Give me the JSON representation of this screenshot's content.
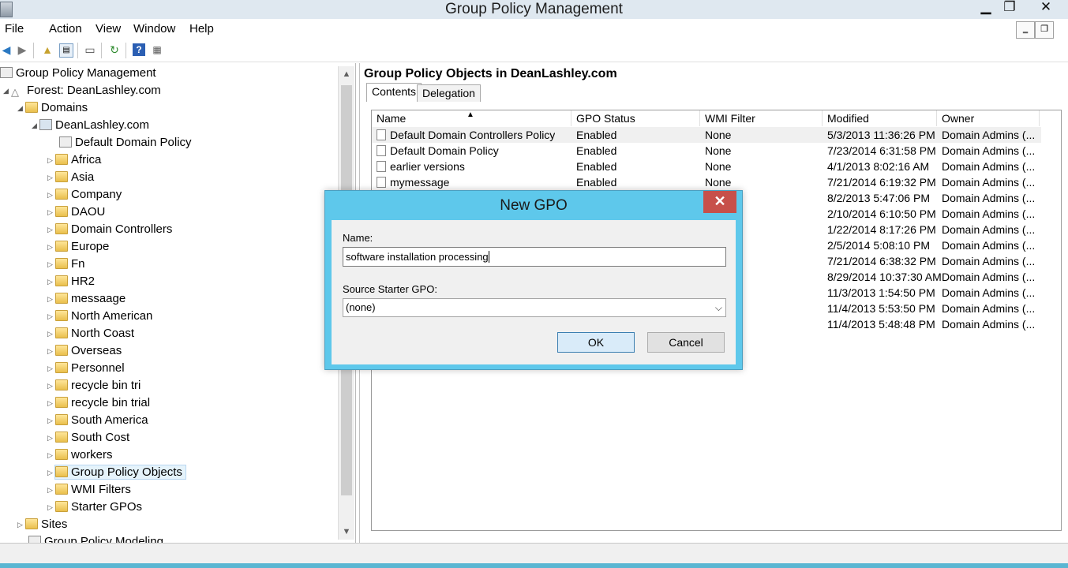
{
  "window": {
    "title": "Group Policy Management",
    "minimize": "▁",
    "restore": "❐",
    "close": "✕"
  },
  "menu": [
    "File",
    "Action",
    "View",
    "Window",
    "Help"
  ],
  "mdi": {
    "minimize": "‗",
    "restore": "❐"
  },
  "tree": {
    "root": "Group Policy Management",
    "forest": "Forest: DeanLashley.com",
    "domains": "Domains",
    "domain": "DeanLashley.com",
    "ddp": "Default Domain Policy",
    "ous": [
      "Africa",
      "Asia",
      "Company",
      "DAOU",
      "Domain Controllers",
      "Europe",
      "Fn",
      "HR2",
      "messaage",
      "North American",
      "North Coast",
      "Overseas",
      "Personnel",
      "recycle bin tri",
      "recycle bin trial",
      "South America",
      "South Cost",
      "workers"
    ],
    "gpo_objects": "Group Policy Objects",
    "wmi_filters": "WMI Filters",
    "starter": "Starter GPOs",
    "sites": "Sites",
    "modeling": "Group Policy Modeling"
  },
  "right": {
    "title": "Group Policy Objects in DeanLashley.com",
    "tabs": [
      "Contents",
      "Delegation"
    ],
    "columns": [
      "Name",
      "GPO Status",
      "WMI Filter",
      "Modified",
      "Owner"
    ],
    "rows": [
      {
        "name": "Default Domain Controllers Policy",
        "status": "Enabled",
        "wmi": "None",
        "modified": "5/3/2013 11:36:26 PM",
        "owner": "Domain Admins (..."
      },
      {
        "name": "Default Domain Policy",
        "status": "Enabled",
        "wmi": "None",
        "modified": "7/23/2014 6:31:58 PM",
        "owner": "Domain Admins (..."
      },
      {
        "name": "earlier versions",
        "status": "Enabled",
        "wmi": "None",
        "modified": "4/1/2013 8:02:16 AM",
        "owner": "Domain Admins (..."
      },
      {
        "name": "mymessage",
        "status": "Enabled",
        "wmi": "None",
        "modified": "7/21/2014 6:19:32 PM",
        "owner": "Domain Admins (..."
      },
      {
        "name": "",
        "status": "",
        "wmi": "",
        "modified": "8/2/2013 5:47:06 PM",
        "owner": "Domain Admins (..."
      },
      {
        "name": "",
        "status": "",
        "wmi": "",
        "modified": "2/10/2014 6:10:50 PM",
        "owner": "Domain Admins (..."
      },
      {
        "name": "",
        "status": "",
        "wmi": "",
        "modified": "1/22/2014 8:17:26 PM",
        "owner": "Domain Admins (..."
      },
      {
        "name": "",
        "status": "",
        "wmi": "",
        "modified": "2/5/2014 5:08:10 PM",
        "owner": "Domain Admins (..."
      },
      {
        "name": "",
        "status": "",
        "wmi": "",
        "modified": "7/21/2014 6:38:32 PM",
        "owner": "Domain Admins (..."
      },
      {
        "name": "",
        "status": "",
        "wmi": "",
        "modified": "8/29/2014 10:37:30 AM",
        "owner": "Domain Admins (..."
      },
      {
        "name": "",
        "status": "",
        "wmi": "",
        "modified": "11/3/2013 1:54:50 PM",
        "owner": "Domain Admins (..."
      },
      {
        "name": "",
        "status": "",
        "wmi": "",
        "modified": "11/4/2013 5:53:50 PM",
        "owner": "Domain Admins (..."
      },
      {
        "name": "",
        "status": "",
        "wmi": "",
        "modified": "11/4/2013 5:48:48 PM",
        "owner": "Domain Admins (..."
      }
    ]
  },
  "dialog": {
    "title": "New GPO",
    "close": "✕",
    "name_label": "Name:",
    "name_value": "software installation processing",
    "source_label": "Source Starter GPO:",
    "source_value": "(none)",
    "ok": "OK",
    "cancel": "Cancel"
  },
  "colors": {
    "dialog_frame": "#5ec8eb",
    "close_button": "#c7504a",
    "ok_button": "#d9ebf9"
  }
}
